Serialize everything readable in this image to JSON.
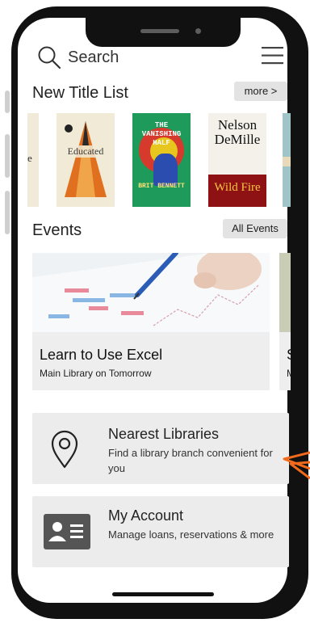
{
  "search": {
    "label": "Search"
  },
  "new_titles": {
    "title": "New Title List",
    "more_label": "more >",
    "books": [
      {
        "title": "Educated",
        "accent": "#e07a1f"
      },
      {
        "title": "THE VANISHING HALF",
        "author": "BRIT BENNETT",
        "accent": "#d8c21a"
      },
      {
        "title": "Nelson DeMille",
        "subtitle": "Wild Fire",
        "accent": "#b0161b"
      }
    ]
  },
  "events": {
    "title": "Events",
    "all_label": "All Events",
    "cards": [
      {
        "title": "Learn to Use Excel",
        "subtitle": "Main Library on Tomorrow"
      },
      {
        "title": "Se",
        "subtitle": "Ma"
      }
    ]
  },
  "nav": {
    "nearest": {
      "title": "Nearest Libraries",
      "description": "Find a library branch convenient for you"
    },
    "account": {
      "title": "My Account",
      "description": "Manage loans, reservations & more"
    }
  },
  "colors": {
    "arrow": "#f26a1b",
    "card_bg": "#ececec",
    "button_bg": "#e3e3e3"
  }
}
